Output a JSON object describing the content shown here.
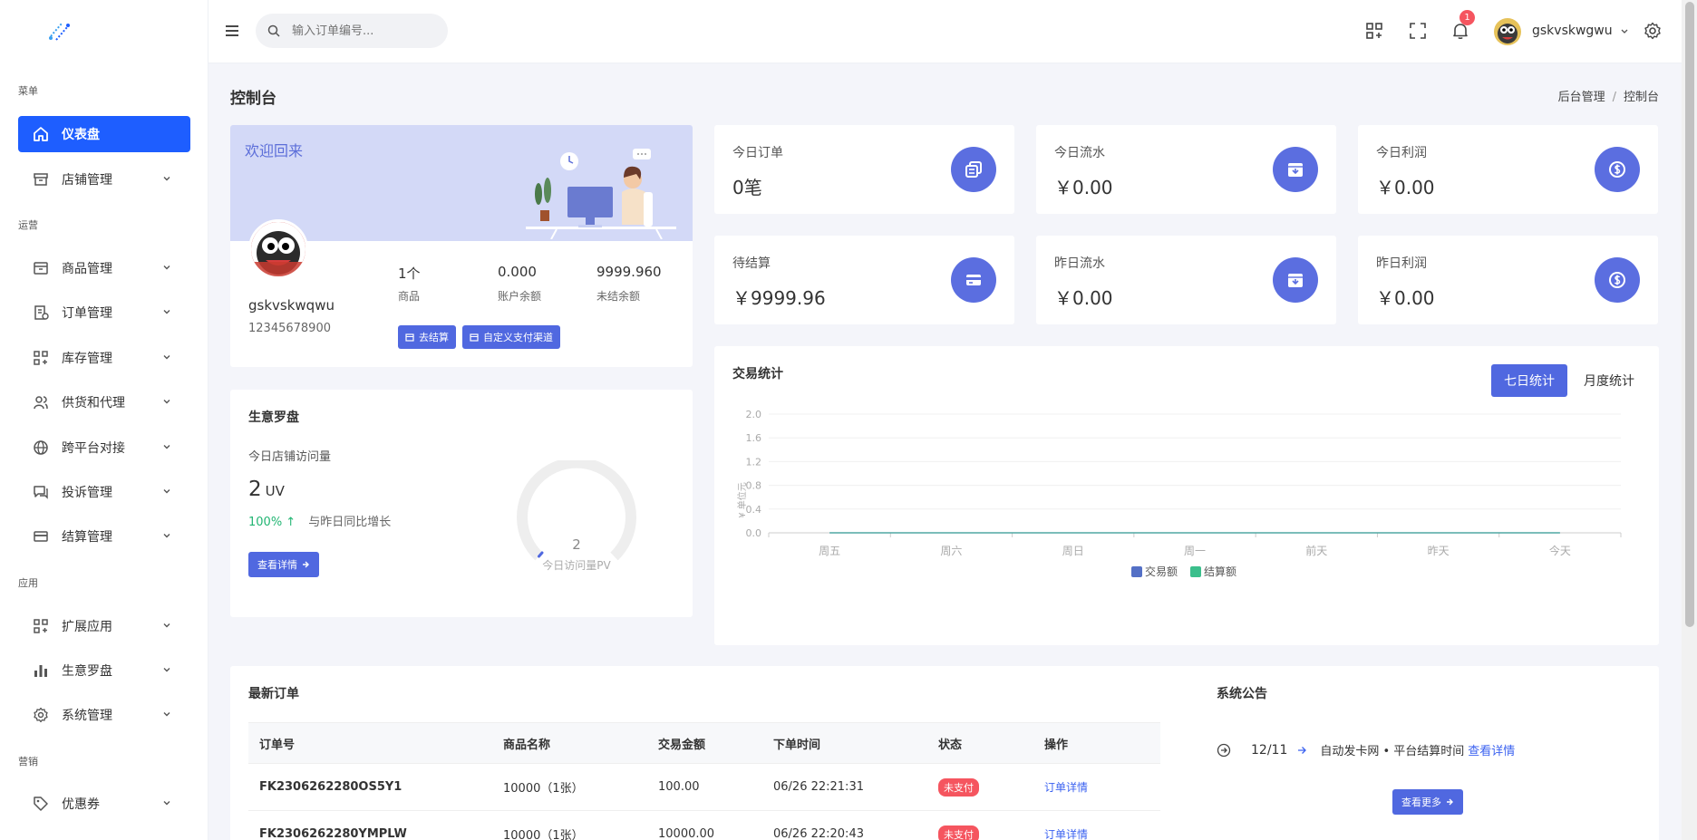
{
  "sidebar": {
    "sections": [
      "菜单",
      "运营",
      "应用",
      "营销"
    ],
    "items": [
      {
        "label": "仪表盘",
        "icon": "home-icon"
      },
      {
        "label": "店铺管理",
        "icon": "store-icon"
      },
      {
        "label": "商品管理",
        "icon": "box-icon"
      },
      {
        "label": "订单管理",
        "icon": "order-icon"
      },
      {
        "label": "库存管理",
        "icon": "grid-icon"
      },
      {
        "label": "供货和代理",
        "icon": "users-icon"
      },
      {
        "label": "跨平台对接",
        "icon": "globe-icon"
      },
      {
        "label": "投诉管理",
        "icon": "chat-icon"
      },
      {
        "label": "结算管理",
        "icon": "card-icon"
      },
      {
        "label": "扩展应用",
        "icon": "apps-icon"
      },
      {
        "label": "生意罗盘",
        "icon": "bar-chart-icon"
      },
      {
        "label": "系统管理",
        "icon": "gear-icon"
      },
      {
        "label": "优惠券",
        "icon": "tag-icon"
      }
    ]
  },
  "header": {
    "search_placeholder": "输入订单编号...",
    "notification_count": "1",
    "username": "gskvskwgwu"
  },
  "page": {
    "title": "控制台",
    "breadcrumb": [
      "后台管理",
      "控制台"
    ]
  },
  "welcome": {
    "greeting": "欢迎回来",
    "name": "gskvskwqwu",
    "phone": "12345678900",
    "stats": [
      {
        "value": "1个",
        "label": "商品"
      },
      {
        "value": "0.000",
        "label": "账户余额"
      },
      {
        "value": "9999.960",
        "label": "未结余额"
      }
    ],
    "btn_settle": "去结算",
    "btn_channel": "自定义支付渠道"
  },
  "kpis": [
    {
      "label": "今日订单",
      "value": "0笔",
      "icon": "copy-icon"
    },
    {
      "label": "今日流水",
      "value": "￥0.00",
      "icon": "archive-icon"
    },
    {
      "label": "今日利润",
      "value": "￥0.00",
      "icon": "dollar-icon"
    },
    {
      "label": "待结算",
      "value": "￥9999.96",
      "icon": "card-icon"
    },
    {
      "label": "昨日流水",
      "value": "￥0.00",
      "icon": "archive-icon"
    },
    {
      "label": "昨日利润",
      "value": "￥0.00",
      "icon": "dollar-icon"
    }
  ],
  "compass": {
    "title": "生意罗盘",
    "visits_label": "今日店铺访问量",
    "uv_value": "2",
    "uv_unit": "UV",
    "growth_pct": "100%",
    "growth_text": "与昨日同比增长",
    "btn_detail": "查看详情",
    "gauge_value": "2",
    "gauge_label": "今日访问量PV"
  },
  "trade_chart": {
    "title": "交易统计",
    "tab_week": "七日统计",
    "tab_month": "月度统计"
  },
  "chart_data": {
    "type": "line",
    "ylabel": "¥ 单位元",
    "ylim": [
      0,
      2.0
    ],
    "yticks": [
      "2.0",
      "1.6",
      "1.2",
      "0.8",
      "0.4",
      "0.0"
    ],
    "categories": [
      "周五",
      "周六",
      "周日",
      "周一",
      "前天",
      "昨天",
      "今天"
    ],
    "series": [
      {
        "name": "交易额",
        "values": [
          0,
          0,
          0,
          0,
          0,
          0,
          0
        ],
        "color": "#5470c6"
      },
      {
        "name": "结算额",
        "values": [
          0,
          0,
          0,
          0,
          0,
          0,
          0
        ],
        "color": "#3bbf8c"
      }
    ],
    "legend": "bottom-center"
  },
  "orders": {
    "title": "最新订单",
    "columns": [
      "订单号",
      "商品名称",
      "交易金额",
      "下单时间",
      "状态",
      "操作"
    ],
    "rows": [
      {
        "order_no": "FK2306262280OS5Y1",
        "product": "10000（1张）",
        "amount": "100.00",
        "time": "06/26 22:21:31",
        "status": "未支付",
        "action": "订单详情"
      },
      {
        "order_no": "FK2306262280YMPLW",
        "product": "10000（1张）",
        "amount": "10000.00",
        "time": "06/26 22:20:43",
        "status": "未支付",
        "action": "订单详情"
      }
    ]
  },
  "notice": {
    "title": "系统公告",
    "date": "12/11",
    "text": "自动发卡网 • 平台结算时间",
    "link": "查看详情",
    "btn_more": "查看更多"
  },
  "colors": {
    "primary": "#1e5eff",
    "accent": "#5068e0",
    "icon_bg": "#5b6ee0",
    "danger": "#f5555f",
    "success": "#22b573"
  }
}
